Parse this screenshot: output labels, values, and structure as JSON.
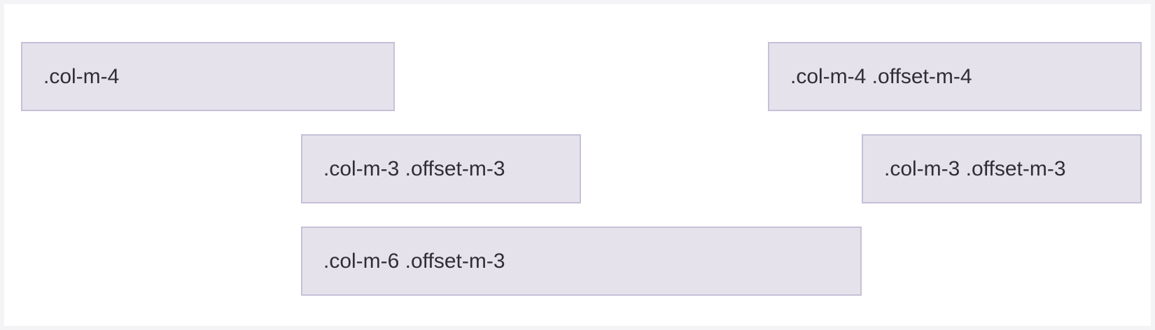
{
  "grid": {
    "rows": [
      {
        "cols": [
          {
            "label": ".col-m-4"
          },
          {
            "label": ".col-m-4 .offset-m-4"
          }
        ]
      },
      {
        "cols": [
          {
            "label": ".col-m-3 .offset-m-3"
          },
          {
            "label": ".col-m-3 .offset-m-3"
          }
        ]
      },
      {
        "cols": [
          {
            "label": ".col-m-6 .offset-m-3"
          }
        ]
      }
    ]
  },
  "colors": {
    "page_background": "#f4f4f6",
    "canvas_background": "#ffffff",
    "column_fill": "#e5e2ec",
    "column_border": "#c7c0d8",
    "text": "#2f2e35"
  }
}
